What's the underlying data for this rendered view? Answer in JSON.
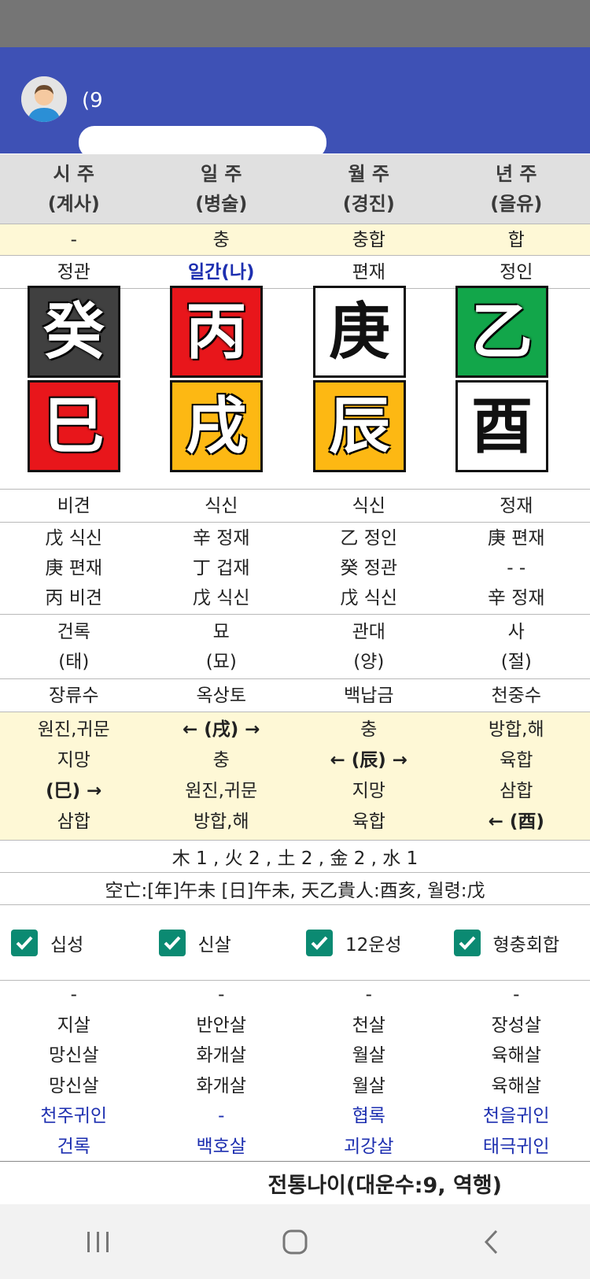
{
  "header": {
    "name_visible": "(9"
  },
  "pillars": [
    {
      "title": "시 주",
      "sub": "(계사)"
    },
    {
      "title": "일 주",
      "sub": "(병술)"
    },
    {
      "title": "월 주",
      "sub": "(경진)"
    },
    {
      "title": "년 주",
      "sub": "(을유)"
    }
  ],
  "relations": [
    "-",
    "충",
    "충합",
    "합"
  ],
  "stem_gods": [
    "정관",
    "일간(나)",
    "편재",
    "정인"
  ],
  "stems": [
    {
      "char": "癸",
      "color": "#404040"
    },
    {
      "char": "丙",
      "color": "#e8161b"
    },
    {
      "char": "庚",
      "color": "#ffffff"
    },
    {
      "char": "乙",
      "color": "#12a64a"
    }
  ],
  "branches": [
    {
      "char": "巳",
      "color": "#e8161b"
    },
    {
      "char": "戌",
      "color": "#fdb813"
    },
    {
      "char": "辰",
      "color": "#fdb813"
    },
    {
      "char": "酉",
      "color": "#ffffff"
    }
  ],
  "branch_gods": [
    "비견",
    "식신",
    "식신",
    "정재"
  ],
  "hidden_stems": [
    [
      "戊 식신",
      "庚 편재",
      "丙 비견"
    ],
    [
      "辛 정재",
      "丁 겁재",
      "戊 식신"
    ],
    [
      "乙 정인",
      "癸 정관",
      "戊 식신"
    ],
    [
      "庚 편재",
      "- -",
      "辛 정재"
    ]
  ],
  "twelve_stages": [
    [
      "건록",
      "(태)"
    ],
    [
      "묘",
      "(묘)"
    ],
    [
      "관대",
      "(양)"
    ],
    [
      "사",
      "(절)"
    ]
  ],
  "napeum": [
    "장류수",
    "옥상토",
    "백납금",
    "천중수"
  ],
  "branch_relations": [
    [
      "원진,귀문",
      "지망",
      "(巳) →",
      "삼합"
    ],
    [
      "← (戌) →",
      "충",
      "원진,귀문",
      "방합,해"
    ],
    [
      "충",
      "← (辰) →",
      "지망",
      "육합"
    ],
    [
      "방합,해",
      "육합",
      "삼합",
      "← (酉)"
    ]
  ],
  "elements": "木 1 , 火 2 , 土 2 , 金 2 , 水 1",
  "gongmang": "空亡:[年]午未 [日]午未, 天乙貴人:酉亥, 월령:戊",
  "checkboxes": [
    {
      "label": "십성",
      "checked": true
    },
    {
      "label": "신살",
      "checked": true
    },
    {
      "label": "12운성",
      "checked": true
    },
    {
      "label": "형충회합",
      "checked": true
    }
  ],
  "shinsal": [
    [
      "-",
      "지살",
      "망신살",
      "망신살",
      "천주귀인",
      "건록"
    ],
    [
      "-",
      "반안살",
      "화개살",
      "화개살",
      "-",
      "백호살"
    ],
    [
      "-",
      "천살",
      "월살",
      "월살",
      "협록",
      "괴강살"
    ],
    [
      "-",
      "장성살",
      "육해살",
      "육해살",
      "천을귀인",
      "태극귀인"
    ]
  ],
  "footer": "전통나이(대운수:9, 역행)",
  "colors": {
    "header": "#3e51b5",
    "check": "#0b8a72",
    "highlight": "#fef8d6",
    "blue_text": "#1d2fb0"
  },
  "nav": {
    "recent": "recent-apps-icon",
    "home": "home-icon",
    "back": "back-icon"
  }
}
